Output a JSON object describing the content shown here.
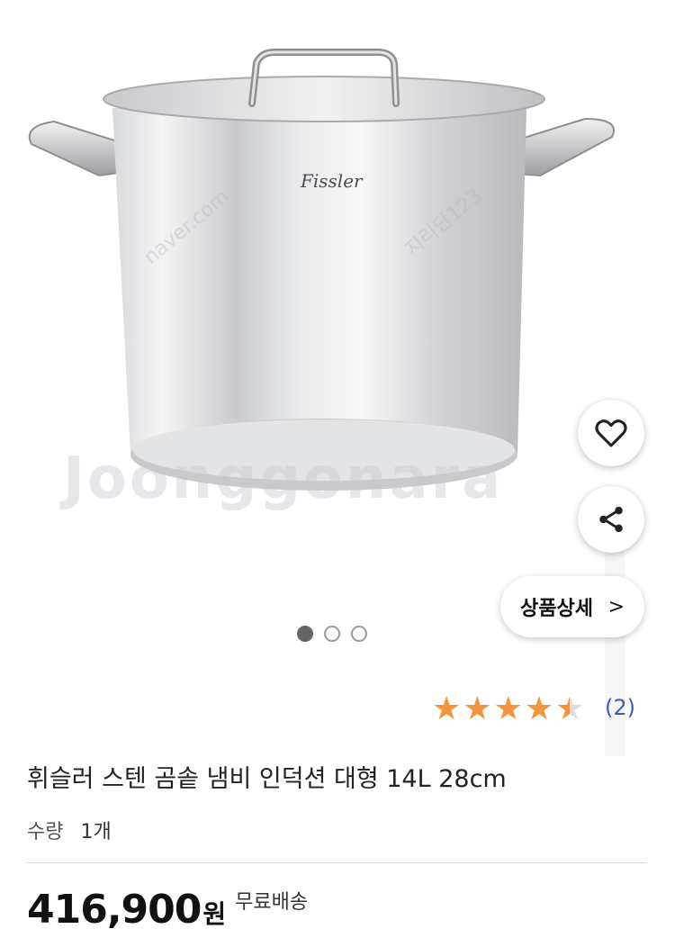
{
  "product_image": {
    "brand_logo_text": "Fissler",
    "watermark_text": "Joonggonara",
    "watermark_small": "naver.com",
    "watermark_small_2": "지리단123"
  },
  "actions": {
    "like_icon": "heart-icon",
    "share_icon": "share-icon",
    "detail_label": "상품상세",
    "detail_chevron": ">"
  },
  "carousel": {
    "total": 3,
    "active_index": 0
  },
  "rating": {
    "stars": 4.5,
    "max_stars": 5,
    "count_text": "(2)",
    "star_color": "#f5943b"
  },
  "product": {
    "title": "휘슬러 스텐 곰솥 냄비 인덕션 대형 14L 28cm",
    "qty_label": "수량",
    "qty_value": "1개",
    "price": "416,900",
    "price_unit": "원",
    "shipping": "무료배송"
  }
}
